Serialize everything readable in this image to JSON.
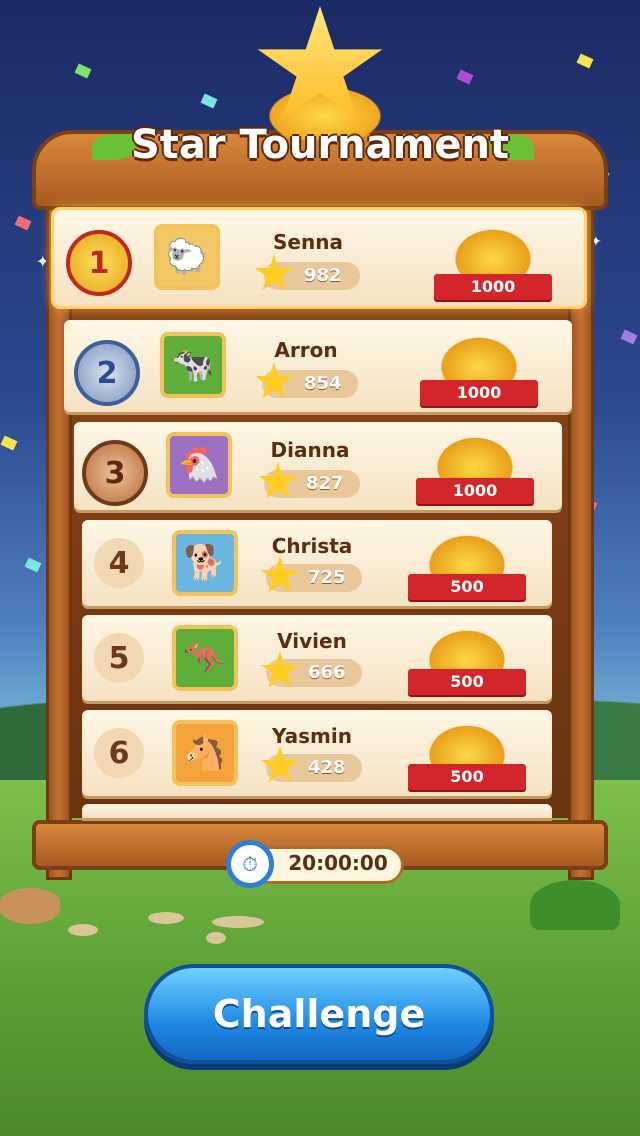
{
  "title": "Star Tournament",
  "leaderboard": [
    {
      "rank": "1",
      "name": "Senna",
      "score": "982",
      "reward": "1000",
      "avatar_icon": "sheep-icon",
      "medal": "gold"
    },
    {
      "rank": "2",
      "name": "Arron",
      "score": "854",
      "reward": "1000",
      "avatar_icon": "cow-icon",
      "medal": "silver"
    },
    {
      "rank": "3",
      "name": "Dianna",
      "score": "827",
      "reward": "1000",
      "avatar_icon": "chicken-icon",
      "medal": "bronze"
    },
    {
      "rank": "4",
      "name": "Christa",
      "score": "725",
      "reward": "500",
      "avatar_icon": "dog-icon"
    },
    {
      "rank": "5",
      "name": "Vivien",
      "score": "666",
      "reward": "500",
      "avatar_icon": "donkey-icon"
    },
    {
      "rank": "6",
      "name": "Yasmin",
      "score": "428",
      "reward": "500",
      "avatar_icon": "horse-icon"
    }
  ],
  "timer": {
    "value": "20:00:00",
    "icon": "alarm-clock-icon"
  },
  "challenge_button": {
    "label": "Challenge"
  },
  "colors": {
    "accent_button": "#1f8ae4",
    "ribbon": "#d3262a",
    "wood": "#a65a20"
  }
}
